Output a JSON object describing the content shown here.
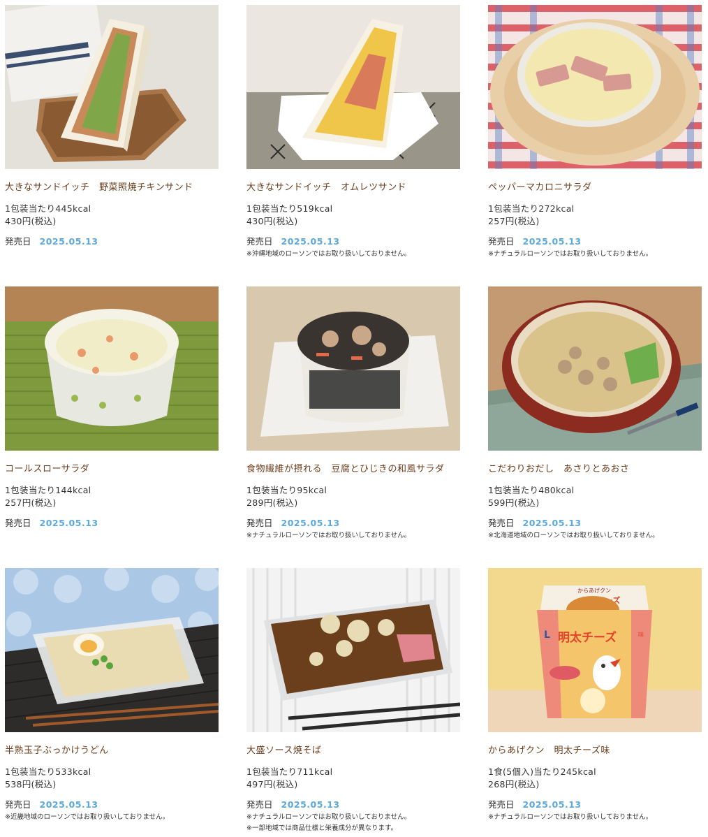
{
  "products": [
    {
      "title": "大きなサンドイッチ　野菜照焼チキンサンド",
      "kcal": "1包装当たり445kcal",
      "price": "430円(税込)",
      "release_label": "発売日",
      "release_date": "2025.05.13",
      "notes": []
    },
    {
      "title": "大きなサンドイッチ　オムレツサンド",
      "kcal": "1包装当たり519kcal",
      "price": "430円(税込)",
      "release_label": "発売日",
      "release_date": "2025.05.13",
      "notes": [
        "※沖縄地域のローソンではお取り扱いしておりません。"
      ]
    },
    {
      "title": "ペッパーマカロニサラダ",
      "kcal": "1包装当たり272kcal",
      "price": "257円(税込)",
      "release_label": "発売日",
      "release_date": "2025.05.13",
      "notes": [
        "※ナチュラルローソンではお取り扱いしておりません。"
      ]
    },
    {
      "title": "コールスローサラダ",
      "kcal": "1包装当たり144kcal",
      "price": "257円(税込)",
      "release_label": "発売日",
      "release_date": "2025.05.13",
      "notes": []
    },
    {
      "title": "食物繊維が摂れる　豆腐とひじきの和風サラダ",
      "kcal": "1包装当たり95kcal",
      "price": "289円(税込)",
      "release_label": "発売日",
      "release_date": "2025.05.13",
      "notes": [
        "※ナチュラルローソンではお取り扱いしておりません。"
      ]
    },
    {
      "title": "こだわりおだし　あさりとあおさ",
      "kcal": "1包装当たり480kcal",
      "price": "599円(税込)",
      "release_label": "発売日",
      "release_date": "2025.05.13",
      "notes": [
        "※北海道地域のローソンではお取り扱いしておりません。"
      ]
    },
    {
      "title": "半熟玉子ぶっかけうどん",
      "kcal": "1包装当たり533kcal",
      "price": "538円(税込)",
      "release_label": "発売日",
      "release_date": "2025.05.13",
      "notes": [
        "※近畿地域のローソンではお取り扱いしておりません。"
      ]
    },
    {
      "title": "大盛ソース焼そば",
      "kcal": "1包装当たり711kcal",
      "price": "497円(税込)",
      "release_label": "発売日",
      "release_date": "2025.05.13",
      "notes": [
        "※ナチュラルローソンではお取り扱いしておりません。",
        "※一部地域では商品仕様と栄養成分が異なります。"
      ]
    },
    {
      "title": "からあげクン　明太チーズ味",
      "kcal": "1食(5個入)当たり245kcal",
      "price": "268円(税込)",
      "release_label": "発売日",
      "release_date": "2025.05.13",
      "notes": [
        "※ナチュラルローソンではお取り扱いしておりません。"
      ]
    }
  ],
  "package_text": {
    "brand": "からあげクン",
    "flavor_small": "明太チーズ",
    "flavor_large": "明太チーズ",
    "flavor_suffix": "味",
    "logo": "L"
  },
  "colors": {
    "title": "#6b3d1b",
    "date": "#5ba9dc",
    "text": "#333333"
  }
}
